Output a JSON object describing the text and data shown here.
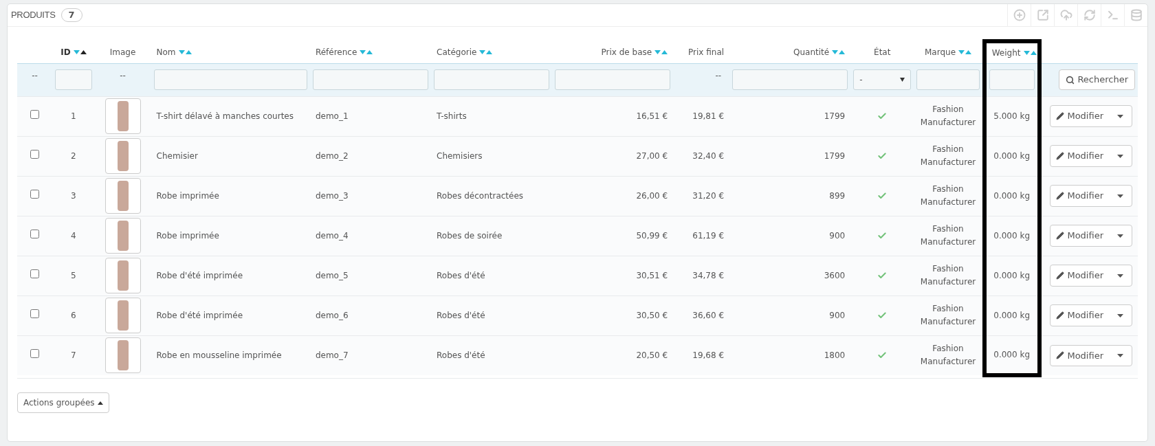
{
  "panel": {
    "title": "PRODUITS",
    "count": "7"
  },
  "toolbar": [
    {
      "kind": "add"
    },
    {
      "kind": "export"
    },
    {
      "kind": "import"
    },
    {
      "kind": "refresh"
    },
    {
      "kind": "sql"
    },
    {
      "kind": "database"
    }
  ],
  "columns": [
    {
      "kind": "select",
      "sortable": false,
      "filterable": false,
      "highlighted": false
    },
    {
      "kind": "id",
      "label": "ID",
      "sortable": true,
      "sorted": true,
      "filterable": true,
      "highlighted": false
    },
    {
      "kind": "image",
      "label": "Image",
      "sortable": false,
      "filterable": false,
      "highlighted": false
    },
    {
      "kind": "text",
      "label": "Nom",
      "sortable": true,
      "sorted": false,
      "filterable": true,
      "highlighted": false
    },
    {
      "kind": "text",
      "label": "Référence",
      "sortable": true,
      "sorted": false,
      "filterable": true,
      "highlighted": false
    },
    {
      "kind": "text",
      "label": "Catégorie",
      "sortable": true,
      "sorted": false,
      "filterable": true,
      "highlighted": false
    },
    {
      "kind": "number",
      "label": "Prix de base",
      "sortable": true,
      "sorted": false,
      "filterable": true,
      "highlighted": false
    },
    {
      "kind": "number",
      "label": "Prix final",
      "sortable": false,
      "filterable": false,
      "highlighted": false
    },
    {
      "kind": "number",
      "label": "Quantité",
      "sortable": true,
      "sorted": false,
      "filterable": true,
      "highlighted": false
    },
    {
      "kind": "status",
      "label": "État",
      "sortable": false,
      "filterable": true,
      "highlighted": false
    },
    {
      "kind": "brand",
      "label": "Marque",
      "sortable": true,
      "sorted": false,
      "filterable": true,
      "highlighted": false
    },
    {
      "kind": "weight",
      "label": "Weight",
      "sortable": true,
      "sorted": false,
      "filterable": true,
      "highlighted": true
    },
    {
      "kind": "actions",
      "sortable": false,
      "filterable": true,
      "highlighted": false
    }
  ],
  "filters": {
    "empty": "--",
    "status_value": "-",
    "search_button": "Rechercher"
  },
  "rows": [
    {
      "checked": false,
      "id": "1",
      "name": "T-shirt délavé à manches courtes",
      "reference": "demo_1",
      "category": "T-shirts",
      "base_price": "16,51 €",
      "final_price": "19,81 €",
      "quantity": "1799",
      "active": true,
      "brand": "Fashion Manufacturer",
      "weight": "5.000 kg",
      "action": "Modifier"
    },
    {
      "checked": false,
      "id": "2",
      "name": "Chemisier",
      "reference": "demo_2",
      "category": "Chemisiers",
      "base_price": "27,00 €",
      "final_price": "32,40 €",
      "quantity": "1799",
      "active": true,
      "brand": "Fashion Manufacturer",
      "weight": "0.000 kg",
      "action": "Modifier"
    },
    {
      "checked": false,
      "id": "3",
      "name": "Robe imprimée",
      "reference": "demo_3",
      "category": "Robes décontractées",
      "base_price": "26,00 €",
      "final_price": "31,20 €",
      "quantity": "899",
      "active": true,
      "brand": "Fashion Manufacturer",
      "weight": "0.000 kg",
      "action": "Modifier"
    },
    {
      "checked": false,
      "id": "4",
      "name": "Robe imprimée",
      "reference": "demo_4",
      "category": "Robes de soirée",
      "base_price": "50,99 €",
      "final_price": "61,19 €",
      "quantity": "900",
      "active": true,
      "brand": "Fashion Manufacturer",
      "weight": "0.000 kg",
      "action": "Modifier"
    },
    {
      "checked": false,
      "id": "5",
      "name": "Robe d'été imprimée",
      "reference": "demo_5",
      "category": "Robes d'été",
      "base_price": "30,51 €",
      "final_price": "34,78 €",
      "quantity": "3600",
      "active": true,
      "brand": "Fashion Manufacturer",
      "weight": "0.000 kg",
      "action": "Modifier"
    },
    {
      "checked": false,
      "id": "6",
      "name": "Robe d'été imprimée",
      "reference": "demo_6",
      "category": "Robes d'été",
      "base_price": "30,50 €",
      "final_price": "36,60 €",
      "quantity": "900",
      "active": true,
      "brand": "Fashion Manufacturer",
      "weight": "0.000 kg",
      "action": "Modifier"
    },
    {
      "checked": false,
      "id": "7",
      "name": "Robe en mousseline imprimée",
      "reference": "demo_7",
      "category": "Robes d'été",
      "base_price": "20,50 €",
      "final_price": "19,68 €",
      "quantity": "1800",
      "active": true,
      "brand": "Fashion Manufacturer",
      "weight": "0.000 kg",
      "action": "Modifier"
    }
  ],
  "bulk_actions": {
    "label": "Actions groupées"
  }
}
